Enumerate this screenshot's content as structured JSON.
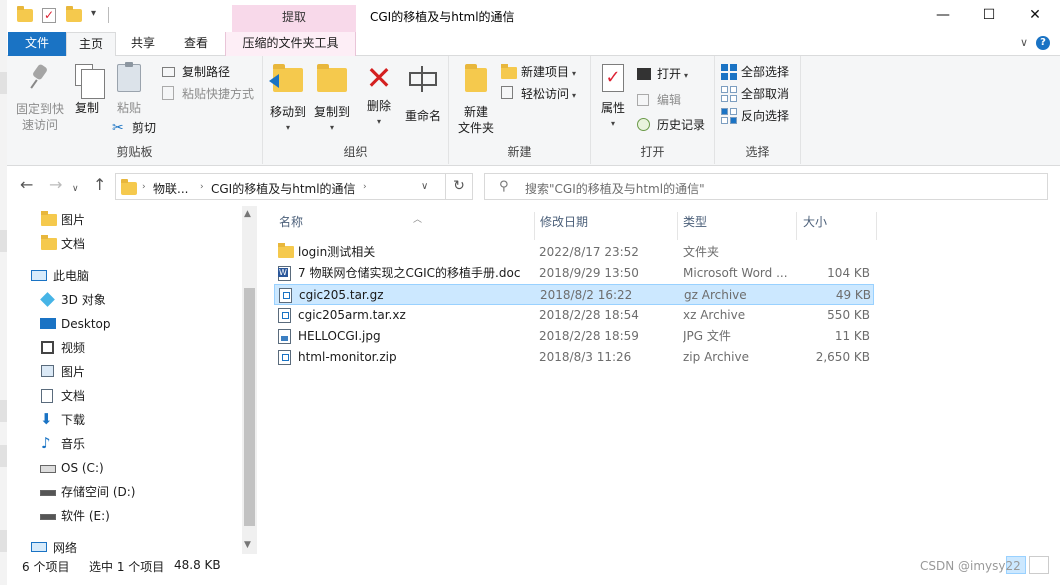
{
  "window": {
    "title": "CGI的移植及与html的通信",
    "context_tab_head": "提取",
    "controls": {
      "minimize": "—",
      "maximize": "☐",
      "close": "✕"
    }
  },
  "ribbon_tabs": [
    {
      "label": "文件"
    },
    {
      "label": "主页"
    },
    {
      "label": "共享"
    },
    {
      "label": "查看"
    },
    {
      "label": "压缩的文件夹工具"
    }
  ],
  "ribbon_right": {
    "collapse": "∨",
    "help": "?"
  },
  "ribbon": {
    "clipboard": {
      "group_label": "剪贴板",
      "pin": "固定到快速访问",
      "pin_line1": "固定到快",
      "pin_line2": "速访问",
      "copy": "复制",
      "paste": "粘贴",
      "copy_path": "复制路径",
      "paste_shortcut": "粘贴快捷方式",
      "cut": "剪切"
    },
    "organize": {
      "group_label": "组织",
      "move_to": "移动到",
      "copy_to": "复制到",
      "delete": "删除",
      "rename": "重命名"
    },
    "new": {
      "group_label": "新建",
      "new_folder_line1": "新建",
      "new_folder_line2": "文件夹",
      "new_item": "新建项目",
      "easy_access": "轻松访问"
    },
    "open": {
      "group_label": "打开",
      "properties": "属性",
      "open": "打开",
      "edit": "编辑",
      "history": "历史记录"
    },
    "select": {
      "group_label": "选择",
      "select_all": "全部选择",
      "select_none": "全部取消",
      "invert": "反向选择"
    }
  },
  "address": {
    "crumbs": [
      "物联...",
      "CGI的移植及与html的通信"
    ],
    "search_placeholder": "搜索\"CGI的移植及与html的通信\""
  },
  "nav_pane": [
    {
      "label": "图片",
      "icon": "folder-icon"
    },
    {
      "label": "文档",
      "icon": "folder-icon"
    },
    {
      "label": "此电脑",
      "icon": "computer-icon"
    },
    {
      "label": "3D 对象",
      "icon": "3d-objects-icon"
    },
    {
      "label": "Desktop",
      "icon": "desktop-icon"
    },
    {
      "label": "视频",
      "icon": "video-icon"
    },
    {
      "label": "图片",
      "icon": "pictures-icon"
    },
    {
      "label": "文档",
      "icon": "documents-icon"
    },
    {
      "label": "下载",
      "icon": "download-icon"
    },
    {
      "label": "音乐",
      "icon": "music-icon"
    },
    {
      "label": "OS (C:)",
      "icon": "drive-c-icon"
    },
    {
      "label": "存储空间 (D:)",
      "icon": "drive-d-icon"
    },
    {
      "label": "软件 (E:)",
      "icon": "drive-e-icon"
    },
    {
      "label": "网络",
      "icon": "network-icon"
    }
  ],
  "columns": [
    "名称",
    "修改日期",
    "类型",
    "大小"
  ],
  "files": [
    {
      "name": "login测试相关",
      "date": "2022/8/17 23:52",
      "type": "文件夹",
      "size": "",
      "icon": "folder-icon"
    },
    {
      "name": "7 物联网仓储实现之CGIC的移植手册.doc",
      "date": "2018/9/29 13:50",
      "type": "Microsoft Word ...",
      "size": "104 KB",
      "icon": "word-doc-icon"
    },
    {
      "name": "cgic205.tar.gz",
      "date": "2018/8/2 16:22",
      "type": "gz Archive",
      "size": "49 KB",
      "icon": "archive-icon"
    },
    {
      "name": "cgic205arm.tar.xz",
      "date": "2018/2/28 18:54",
      "type": "xz Archive",
      "size": "550 KB",
      "icon": "archive-icon"
    },
    {
      "name": "HELLOCGI.jpg",
      "date": "2018/2/28 18:59",
      "type": "JPG 文件",
      "size": "11 KB",
      "icon": "jpg-file-icon"
    },
    {
      "name": "html-monitor.zip",
      "date": "2018/8/3 11:26",
      "type": "zip Archive",
      "size": "2,650 KB",
      "icon": "zip-archive-icon"
    }
  ],
  "status": {
    "item_count": "6 个项目",
    "selected": "选中 1 个项目",
    "size": "48.8 KB"
  },
  "watermark": "CSDN @imysy22",
  "colors": {
    "accent": "#1a73c4",
    "selection": "#cce8ff",
    "context_tab": "#f8d9ea",
    "folder": "#f5c94d",
    "delete": "#d42020"
  }
}
